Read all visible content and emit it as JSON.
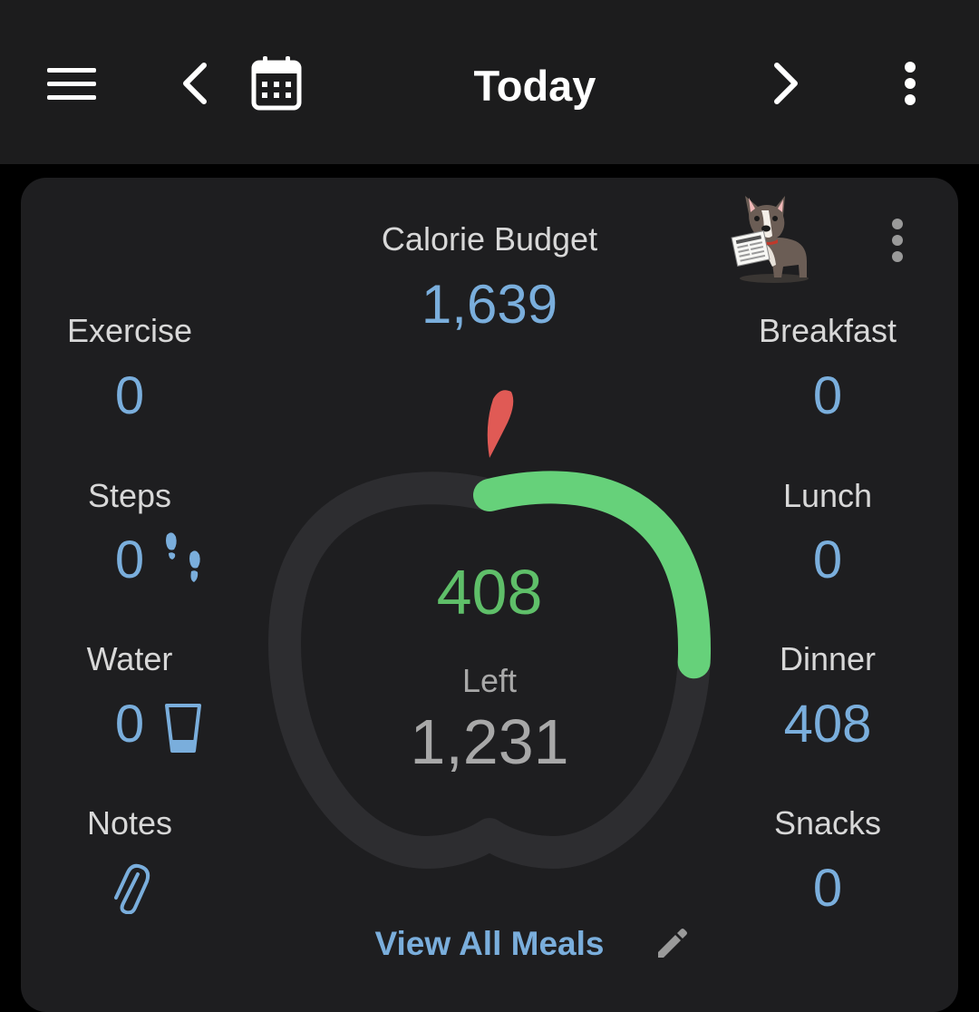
{
  "header": {
    "title": "Today",
    "icons": {
      "menu": "hamburger-menu-icon",
      "prev": "chevron-left-icon",
      "calendar": "calendar-icon",
      "next": "chevron-right-icon",
      "more": "more-vertical-icon"
    }
  },
  "summary": {
    "budget_label": "Calorie Budget",
    "budget_value": "1,639",
    "consumed_value": "408",
    "left_label": "Left",
    "left_value": "1,231",
    "progress_fraction": 0.249,
    "view_all_label": "View All Meals",
    "mascot": "dog-mascot-with-newspaper",
    "more_icon": "more-vertical-icon",
    "edit_icon": "pencil-icon"
  },
  "left_column": {
    "exercise": {
      "label": "Exercise",
      "value": "0"
    },
    "steps": {
      "label": "Steps",
      "value": "0",
      "icon": "footprints-icon"
    },
    "water": {
      "label": "Water",
      "value": "0",
      "icon": "water-glass-icon"
    },
    "notes": {
      "label": "Notes",
      "icon": "paperclip-icon"
    }
  },
  "right_column": {
    "breakfast": {
      "label": "Breakfast",
      "value": "0"
    },
    "lunch": {
      "label": "Lunch",
      "value": "0"
    },
    "dinner": {
      "label": "Dinner",
      "value": "408"
    },
    "snacks": {
      "label": "Snacks",
      "value": "0"
    }
  },
  "colors": {
    "accent_blue": "#7aaedc",
    "progress_green": "#66d17a",
    "consumed_green": "#5fbf69",
    "apple_stem_red": "#e05a55",
    "card_bg": "#1e1e20",
    "topbar_bg": "#1c1c1d"
  }
}
